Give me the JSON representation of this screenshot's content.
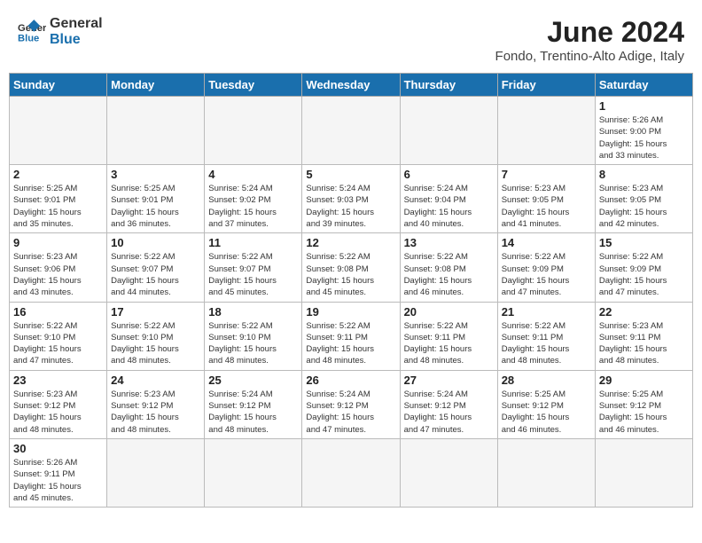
{
  "header": {
    "logo_general": "General",
    "logo_blue": "Blue",
    "title": "June 2024",
    "subtitle": "Fondo, Trentino-Alto Adige, Italy"
  },
  "weekdays": [
    "Sunday",
    "Monday",
    "Tuesday",
    "Wednesday",
    "Thursday",
    "Friday",
    "Saturday"
  ],
  "weeks": [
    [
      {
        "day": "",
        "info": ""
      },
      {
        "day": "",
        "info": ""
      },
      {
        "day": "",
        "info": ""
      },
      {
        "day": "",
        "info": ""
      },
      {
        "day": "",
        "info": ""
      },
      {
        "day": "",
        "info": ""
      },
      {
        "day": "1",
        "info": "Sunrise: 5:26 AM\nSunset: 9:00 PM\nDaylight: 15 hours\nand 33 minutes."
      }
    ],
    [
      {
        "day": "2",
        "info": "Sunrise: 5:25 AM\nSunset: 9:01 PM\nDaylight: 15 hours\nand 35 minutes."
      },
      {
        "day": "3",
        "info": "Sunrise: 5:25 AM\nSunset: 9:01 PM\nDaylight: 15 hours\nand 36 minutes."
      },
      {
        "day": "4",
        "info": "Sunrise: 5:24 AM\nSunset: 9:02 PM\nDaylight: 15 hours\nand 37 minutes."
      },
      {
        "day": "5",
        "info": "Sunrise: 5:24 AM\nSunset: 9:03 PM\nDaylight: 15 hours\nand 39 minutes."
      },
      {
        "day": "6",
        "info": "Sunrise: 5:24 AM\nSunset: 9:04 PM\nDaylight: 15 hours\nand 40 minutes."
      },
      {
        "day": "7",
        "info": "Sunrise: 5:23 AM\nSunset: 9:05 PM\nDaylight: 15 hours\nand 41 minutes."
      },
      {
        "day": "8",
        "info": "Sunrise: 5:23 AM\nSunset: 9:05 PM\nDaylight: 15 hours\nand 42 minutes."
      }
    ],
    [
      {
        "day": "9",
        "info": "Sunrise: 5:23 AM\nSunset: 9:06 PM\nDaylight: 15 hours\nand 43 minutes."
      },
      {
        "day": "10",
        "info": "Sunrise: 5:22 AM\nSunset: 9:07 PM\nDaylight: 15 hours\nand 44 minutes."
      },
      {
        "day": "11",
        "info": "Sunrise: 5:22 AM\nSunset: 9:07 PM\nDaylight: 15 hours\nand 45 minutes."
      },
      {
        "day": "12",
        "info": "Sunrise: 5:22 AM\nSunset: 9:08 PM\nDaylight: 15 hours\nand 45 minutes."
      },
      {
        "day": "13",
        "info": "Sunrise: 5:22 AM\nSunset: 9:08 PM\nDaylight: 15 hours\nand 46 minutes."
      },
      {
        "day": "14",
        "info": "Sunrise: 5:22 AM\nSunset: 9:09 PM\nDaylight: 15 hours\nand 47 minutes."
      },
      {
        "day": "15",
        "info": "Sunrise: 5:22 AM\nSunset: 9:09 PM\nDaylight: 15 hours\nand 47 minutes."
      }
    ],
    [
      {
        "day": "16",
        "info": "Sunrise: 5:22 AM\nSunset: 9:10 PM\nDaylight: 15 hours\nand 47 minutes."
      },
      {
        "day": "17",
        "info": "Sunrise: 5:22 AM\nSunset: 9:10 PM\nDaylight: 15 hours\nand 48 minutes."
      },
      {
        "day": "18",
        "info": "Sunrise: 5:22 AM\nSunset: 9:10 PM\nDaylight: 15 hours\nand 48 minutes."
      },
      {
        "day": "19",
        "info": "Sunrise: 5:22 AM\nSunset: 9:11 PM\nDaylight: 15 hours\nand 48 minutes."
      },
      {
        "day": "20",
        "info": "Sunrise: 5:22 AM\nSunset: 9:11 PM\nDaylight: 15 hours\nand 48 minutes."
      },
      {
        "day": "21",
        "info": "Sunrise: 5:22 AM\nSunset: 9:11 PM\nDaylight: 15 hours\nand 48 minutes."
      },
      {
        "day": "22",
        "info": "Sunrise: 5:23 AM\nSunset: 9:11 PM\nDaylight: 15 hours\nand 48 minutes."
      }
    ],
    [
      {
        "day": "23",
        "info": "Sunrise: 5:23 AM\nSunset: 9:12 PM\nDaylight: 15 hours\nand 48 minutes."
      },
      {
        "day": "24",
        "info": "Sunrise: 5:23 AM\nSunset: 9:12 PM\nDaylight: 15 hours\nand 48 minutes."
      },
      {
        "day": "25",
        "info": "Sunrise: 5:24 AM\nSunset: 9:12 PM\nDaylight: 15 hours\nand 48 minutes."
      },
      {
        "day": "26",
        "info": "Sunrise: 5:24 AM\nSunset: 9:12 PM\nDaylight: 15 hours\nand 47 minutes."
      },
      {
        "day": "27",
        "info": "Sunrise: 5:24 AM\nSunset: 9:12 PM\nDaylight: 15 hours\nand 47 minutes."
      },
      {
        "day": "28",
        "info": "Sunrise: 5:25 AM\nSunset: 9:12 PM\nDaylight: 15 hours\nand 46 minutes."
      },
      {
        "day": "29",
        "info": "Sunrise: 5:25 AM\nSunset: 9:12 PM\nDaylight: 15 hours\nand 46 minutes."
      }
    ],
    [
      {
        "day": "30",
        "info": "Sunrise: 5:26 AM\nSunset: 9:11 PM\nDaylight: 15 hours\nand 45 minutes."
      },
      {
        "day": "",
        "info": ""
      },
      {
        "day": "",
        "info": ""
      },
      {
        "day": "",
        "info": ""
      },
      {
        "day": "",
        "info": ""
      },
      {
        "day": "",
        "info": ""
      },
      {
        "day": "",
        "info": ""
      }
    ]
  ]
}
